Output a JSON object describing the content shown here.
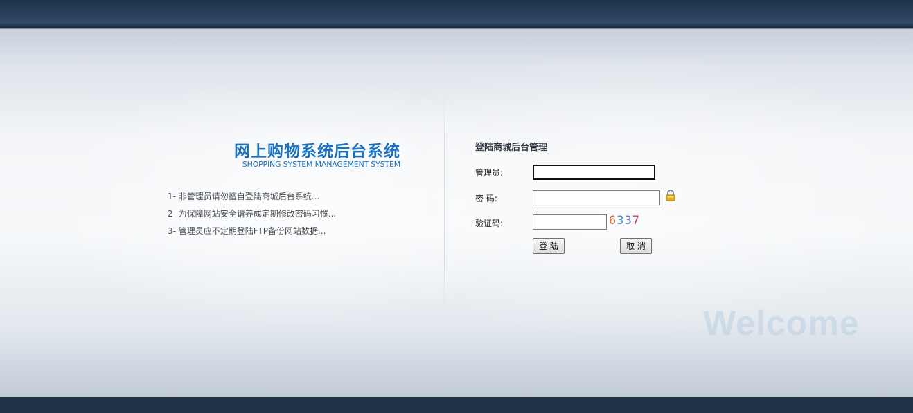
{
  "header": {
    "title_cn": "网上购物系统后台系统",
    "title_en": "SHOPPING SYSTEM MANAGEMENT SYSTEM"
  },
  "tips": [
    "1- 非管理员请勿擅自登陆商城后台系统...",
    "2- 为保障网站安全请养成定期修改密码习惯...",
    "3- 管理员应不定期登陆FTP备份网站数据..."
  ],
  "login": {
    "title": "登陆商城后台管理",
    "username_label": "管理员:",
    "username_value": "",
    "password_label": "密 码:",
    "password_value": "",
    "captcha_label": "验证码:",
    "captcha_value": "",
    "captcha_digits": [
      "6",
      "3",
      "3",
      "7"
    ],
    "captcha_colors": [
      "#d46b3c",
      "#3d8fc7",
      "#6a7fb8",
      "#c03c6a"
    ],
    "submit_label": "登 陆",
    "cancel_label": "取 消"
  },
  "watermark": "Welcome",
  "icons": {
    "lock": "lock-icon"
  }
}
